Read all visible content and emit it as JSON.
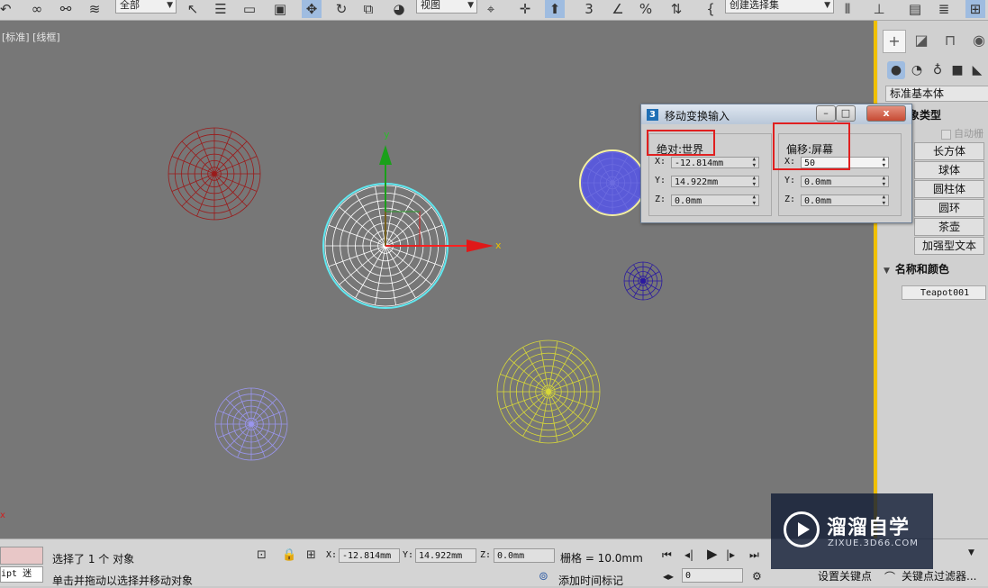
{
  "toolbar": {
    "selection_filter": "全部",
    "ref_coord": "视图",
    "named_selection": "创建选择集"
  },
  "viewport": {
    "label": "[标准] [线框]",
    "axis_y": "y",
    "axis_x": "x"
  },
  "dialog": {
    "title": "移动变换输入",
    "absolute_title": "绝对:世界",
    "offset_title": "偏移:屏幕",
    "absolute": {
      "x_label": "X:",
      "x": "-12.814mm",
      "y_label": "Y:",
      "y": "14.922mm",
      "z_label": "Z:",
      "z": "0.0mm"
    },
    "offset": {
      "x_label": "X:",
      "x": "50",
      "y_label": "Y:",
      "y": "0.0mm",
      "z_label": "Z:",
      "z": "0.0mm"
    },
    "minimize": "–",
    "maximize": "□",
    "close": "x"
  },
  "command_panel": {
    "category": "标准基本体",
    "object_type_header": "象类型",
    "autogrid": "自动栅",
    "buttons": [
      "长方体",
      "球体",
      "圆柱体",
      "圆环",
      "茶壶",
      "加强型文本"
    ],
    "name_color_header": "名称和颜色",
    "object_name": "Teapot001"
  },
  "status": {
    "maxscript": "ipt 迷",
    "selection": "选择了 1 个 对象",
    "prompt": "单击并拖动以选择并移动对象",
    "x_label": "X:",
    "x": "-12.814mm",
    "y_label": "Y:",
    "y": "14.922mm",
    "z_label": "Z:",
    "z": "0.0mm",
    "grid": "栅格 = 10.0mm",
    "add_time_tag": "添加时间标记",
    "frame": "0",
    "set_key": "设置关键点",
    "key_filters": "关键点过滤器..."
  },
  "watermark": {
    "title": "溜溜自学",
    "url": "ZIXUE.3D66.COM"
  },
  "colors": {
    "viewport_bg": "#777777",
    "active_border": "#f0c000",
    "highlight_red": "#e02020"
  }
}
